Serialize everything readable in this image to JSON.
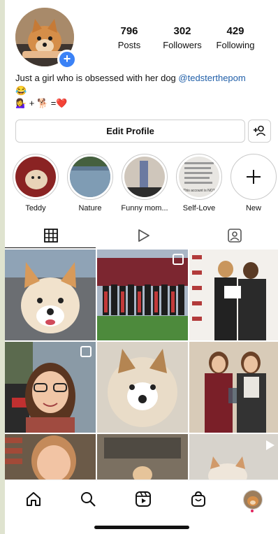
{
  "profile": {
    "stats": [
      {
        "value": "796",
        "label": "Posts"
      },
      {
        "value": "302",
        "label": "Followers"
      },
      {
        "value": "429",
        "label": "Following"
      }
    ],
    "bio_line1": "Just a girl who is obsessed with her dog ",
    "bio_handle": "@tedsterthepom",
    "bio_line2": "😂",
    "bio_line3": "💁‍♀️ + 🐕 =❤️",
    "edit_profile_label": "Edit Profile"
  },
  "highlights": [
    {
      "label": "Teddy"
    },
    {
      "label": "Nature"
    },
    {
      "label": "Funny mom..."
    },
    {
      "label": "Self-Love"
    },
    {
      "label": "New"
    }
  ],
  "highlight_thumb_text": "This account is NOT",
  "tabs": [
    "grid-tab",
    "reels-tab",
    "tagged-tab"
  ],
  "colors": {
    "accent": "#3b82f6",
    "handle": "#1f5ea8",
    "heart": "#d92b2b"
  },
  "icons": {
    "add_avatar": "plus-icon",
    "add_user": "add-person-icon",
    "nav": [
      "home-icon",
      "search-icon",
      "reels-icon",
      "shop-icon",
      "profile-avatar"
    ]
  }
}
